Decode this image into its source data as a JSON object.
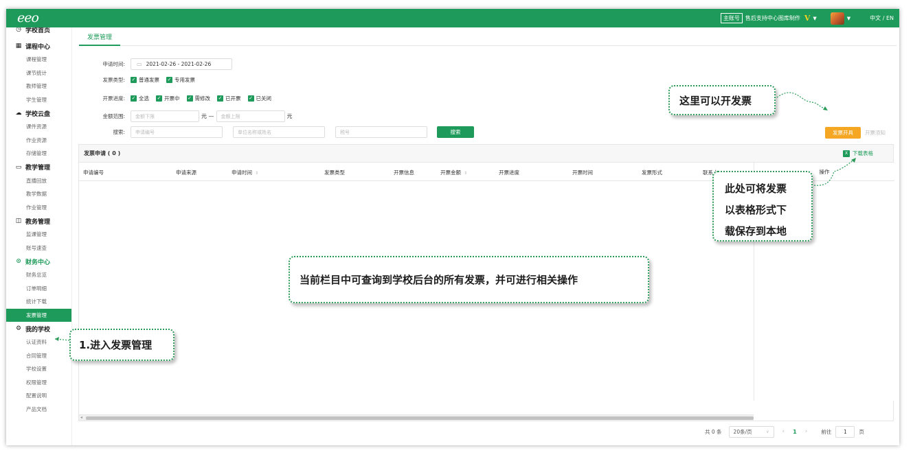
{
  "topbar": {
    "logo": "eeo",
    "account_tag": "主账号",
    "account_name": "售后支持中心图库制作",
    "vip_mark": "V",
    "language": "中文 / EN"
  },
  "sidebar": {
    "sections": [
      {
        "label": "学校首页",
        "icon": "clock-icon",
        "items": []
      },
      {
        "label": "课程中心",
        "icon": "calendar-icon",
        "items": [
          "课程管理",
          "课节统计",
          "教师管理",
          "学生管理"
        ]
      },
      {
        "label": "学校云盘",
        "icon": "cloud-icon",
        "items": [
          "课件资源",
          "作业资源",
          "存储管理"
        ]
      },
      {
        "label": "教学管理",
        "icon": "monitor-icon",
        "items": [
          "直播回放",
          "教学数据",
          "作业管理"
        ]
      },
      {
        "label": "教务管理",
        "icon": "grid-icon",
        "items": [
          "监课管理",
          "账号速查"
        ]
      },
      {
        "label": "财务中心",
        "icon": "money-icon",
        "items": [
          "财务总览",
          "订单明细",
          "统计下载",
          "发票管理"
        ]
      },
      {
        "label": "我的学校",
        "icon": "gear-icon",
        "items": [
          "认证资料",
          "合同管理",
          "学校设置",
          "权限管理",
          "配置说明",
          "产品文档"
        ]
      }
    ],
    "active_section": "财务中心",
    "active_item": "发票管理"
  },
  "tab": {
    "label": "发票管理"
  },
  "filters": {
    "date_label": "申请时间:",
    "date_value": "2021-02-26  - 2021-02-26",
    "type_label": "发票类型:",
    "types": [
      "普通发票",
      "专用发票"
    ],
    "progress_label": "开票进度:",
    "progress": [
      "全选",
      "开票中",
      "需修改",
      "已开票",
      "已关闭"
    ],
    "amount_label": "金额范围:",
    "amount_min_placeholder": "金额下限",
    "amount_max_placeholder": "金额上限",
    "unit": "元",
    "dash": "元 —",
    "search_label": "搜索:",
    "search_no_placeholder": "申请编号",
    "search_name_placeholder": "单位名称或姓名",
    "search_tax_placeholder": "税号",
    "search_button": "搜索"
  },
  "actions": {
    "issue_button": "发票开具",
    "issue_notice": "开票须知"
  },
  "table": {
    "title": "发票申请 ( 0 )",
    "download": "下载表格",
    "columns": [
      "申请编号",
      "申请来源",
      "申请时间",
      "发票类型",
      "开票信息",
      "开票金额",
      "开票进度",
      "开票时间",
      "发票形式",
      "联系人"
    ],
    "op_column": "操作"
  },
  "pager": {
    "total": "共 0 条",
    "page_size": "20条/页",
    "current": "1",
    "goto_label": "前往",
    "goto_value": "1",
    "page_suffix": "页"
  },
  "callouts": {
    "enter": "1.进入发票管理",
    "issue": "这里可以开发票",
    "download_line1": "此处可将发票",
    "download_line2": "以表格形式下",
    "download_line3": "载保存到本地",
    "overview": "当前栏目中可查询到学校后台的所有发票，并可进行相关操作"
  }
}
